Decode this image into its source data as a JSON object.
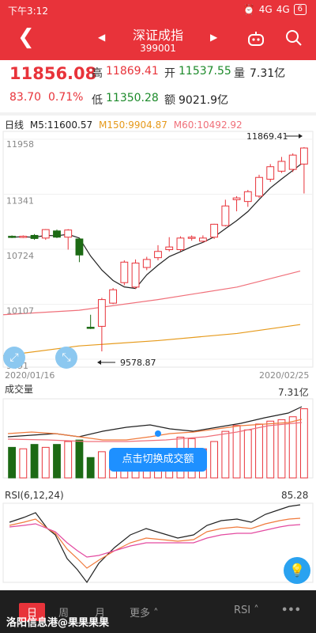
{
  "status": {
    "time": "下午3:12",
    "signal1": "4G",
    "signal2": "4G",
    "battery": "6"
  },
  "header": {
    "title": "深证成指",
    "code": "399001"
  },
  "quote": {
    "price": "11856.08",
    "change": "83.70",
    "change_pct": "0.71%",
    "high_label": "高",
    "high": "11869.41",
    "open_label": "开",
    "open": "11537.55",
    "volume_label": "量",
    "volume": "7.31亿",
    "low_label": "低",
    "low": "11350.28",
    "amount_label": "额",
    "amount": "9021.9亿"
  },
  "ma_legend": {
    "period": "日线",
    "m5": "M5:11600.57",
    "m150": "M150:9904.87",
    "m60": "M60:10492.92"
  },
  "colors": {
    "up": "#e8333a",
    "down": "#1c6a14",
    "m5": "#222222",
    "m150": "#e69a1b",
    "m60": "#f0707a"
  },
  "chart_data": {
    "type": "candlestick",
    "y_ticks": [
      "11958",
      "11341",
      "10724",
      "10107",
      "9491"
    ],
    "ylim": [
      9491,
      11958
    ],
    "x_labels": [
      "2020/01/16",
      "2020/02/25"
    ],
    "max_label": "11869.41",
    "min_label": "9578.87",
    "candles": [
      {
        "o": 10870,
        "c": 10860,
        "h": 10880,
        "l": 10850
      },
      {
        "o": 10860,
        "c": 10870,
        "h": 10880,
        "l": 10850
      },
      {
        "o": 10880,
        "c": 10845,
        "h": 10895,
        "l": 10830
      },
      {
        "o": 10850,
        "c": 10945,
        "h": 10950,
        "l": 10830
      },
      {
        "o": 10930,
        "c": 10860,
        "h": 10945,
        "l": 10850
      },
      {
        "o": 10860,
        "c": 10940,
        "h": 10950,
        "l": 10720
      },
      {
        "o": 10840,
        "c": 10660,
        "h": 10850,
        "l": 10580
      },
      {
        "o": 9850,
        "c": 9840,
        "h": 9990,
        "l": 9830
      },
      {
        "o": 9860,
        "c": 10160,
        "h": 10180,
        "l": 9579
      },
      {
        "o": 10120,
        "c": 10270,
        "h": 10290,
        "l": 10110
      },
      {
        "o": 10350,
        "c": 10580,
        "h": 10600,
        "l": 10320
      },
      {
        "o": 10300,
        "c": 10570,
        "h": 10610,
        "l": 10280
      },
      {
        "o": 10520,
        "c": 10610,
        "h": 10640,
        "l": 10490
      },
      {
        "o": 10630,
        "c": 10700,
        "h": 10770,
        "l": 10600
      },
      {
        "o": 10720,
        "c": 10750,
        "h": 10860,
        "l": 10700
      },
      {
        "o": 10720,
        "c": 10850,
        "h": 10870,
        "l": 10700
      },
      {
        "o": 10850,
        "c": 10860,
        "h": 10880,
        "l": 10820
      },
      {
        "o": 10815,
        "c": 10850,
        "h": 10880,
        "l": 10800
      },
      {
        "o": 10860,
        "c": 11005,
        "h": 11010,
        "l": 10840
      },
      {
        "o": 10990,
        "c": 11210,
        "h": 11280,
        "l": 10980
      },
      {
        "o": 11280,
        "c": 11300,
        "h": 11320,
        "l": 11150
      },
      {
        "o": 11260,
        "c": 11370,
        "h": 11390,
        "l": 11200
      },
      {
        "o": 11320,
        "c": 11530,
        "h": 11560,
        "l": 11300
      },
      {
        "o": 11510,
        "c": 11650,
        "h": 11680,
        "l": 11480
      },
      {
        "o": 11600,
        "c": 11710,
        "h": 11760,
        "l": 11580
      },
      {
        "o": 11620,
        "c": 11780,
        "h": 11800,
        "l": 11590
      },
      {
        "o": 11680,
        "c": 11860,
        "h": 11870,
        "l": 11350
      }
    ],
    "volume_label": "成交量",
    "volume_max_label": "7.31亿",
    "volume_tooltip": "点击切换成交额",
    "rsi_label": "RSI(6,12,24)",
    "rsi_value": "85.28"
  },
  "tabs": {
    "day": "日",
    "week": "周",
    "month": "月",
    "more": "更多",
    "indicator": "RSI"
  },
  "watermark": "洛阳信息港@果果果果",
  "icons": {
    "back": "back-chevron-icon",
    "prev": "prev-triangle-icon",
    "next": "next-triangle-icon",
    "robot": "robot-icon",
    "search": "search-icon",
    "bulb": "lightbulb-icon",
    "fullscreen": "expand-icon"
  }
}
